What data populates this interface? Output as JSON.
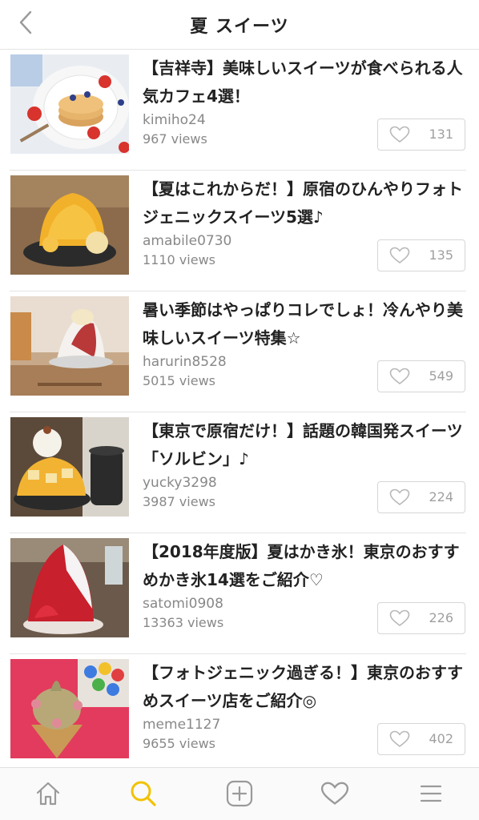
{
  "header": {
    "title": "夏 スイーツ"
  },
  "articles": [
    {
      "title": "【吉祥寺】美味しいスイーツが食べられる人気カフェ4選！",
      "author": "kimiho24",
      "views": "967 views",
      "likes": "131"
    },
    {
      "title": "【夏はこれからだ！】原宿のひんやりフォトジェニックスイーツ5選♪",
      "author": "amabile0730",
      "views": "1110 views",
      "likes": "135"
    },
    {
      "title": "暑い季節はやっぱりコレでしょ！冷んやり美味しいスイーツ特集☆",
      "author": "harurin8528",
      "views": "5015 views",
      "likes": "549"
    },
    {
      "title": "【東京で原宿だけ！】話題の韓国発スイーツ「ソルビン」♪",
      "author": "yucky3298",
      "views": "3987 views",
      "likes": "224"
    },
    {
      "title": "【2018年度版】夏はかき氷！東京のおすすめかき氷14選をご紹介♡",
      "author": "satomi0908",
      "views": "13363 views",
      "likes": "226"
    },
    {
      "title": "【フォトジェニック過ぎる！】東京のおすすめスイーツ店をご紹介◎",
      "author": "meme1127",
      "views": "9655 views",
      "likes": "402"
    }
  ],
  "tabbar": {
    "items": [
      "home-icon",
      "search-icon",
      "add-icon",
      "heart-icon",
      "menu-icon"
    ],
    "active": "search-icon",
    "accent_color": "#f2c200"
  }
}
